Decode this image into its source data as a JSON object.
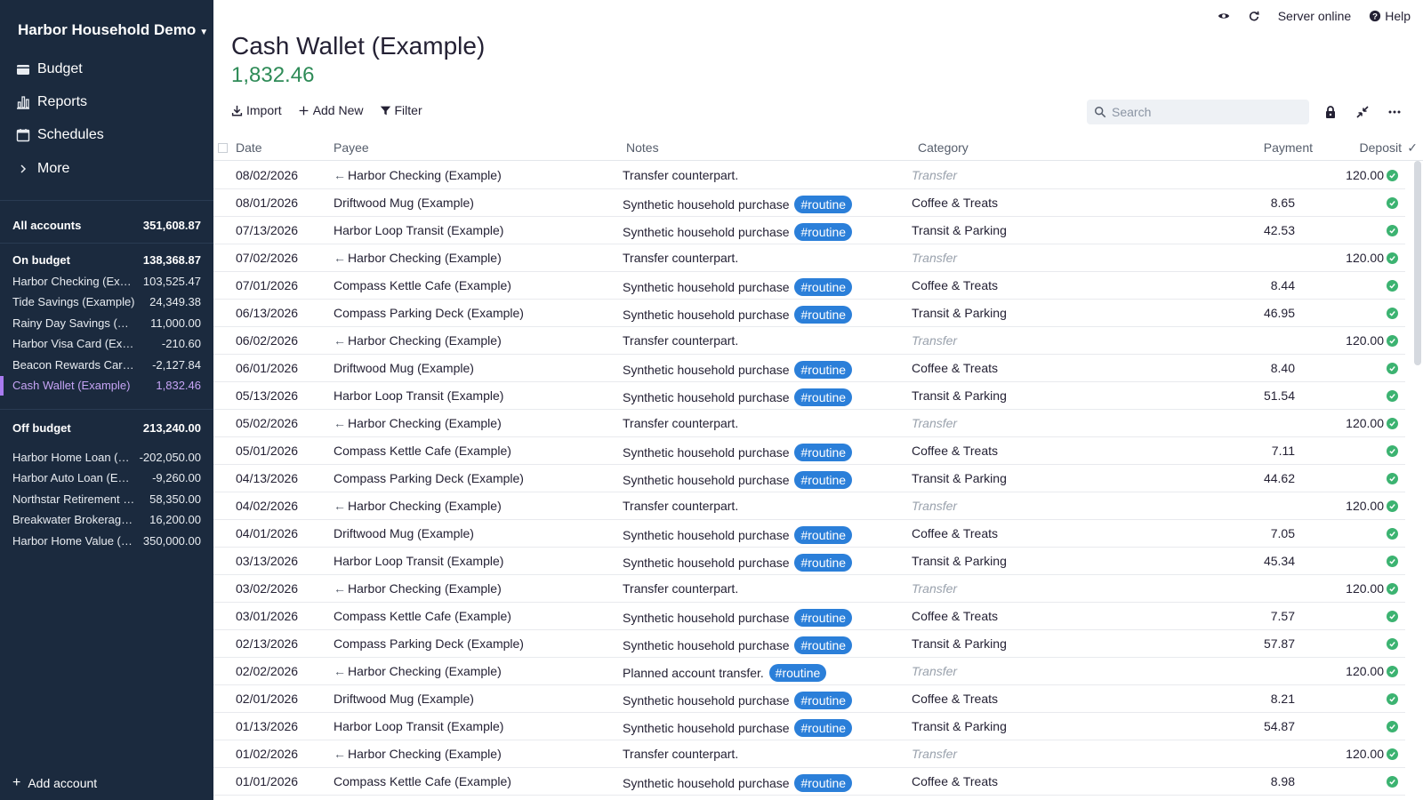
{
  "sidebar": {
    "budget_name": "Harbor Household Demo",
    "nav": [
      {
        "label": "Budget",
        "icon": "wallet-icon"
      },
      {
        "label": "Reports",
        "icon": "bar-chart-icon"
      },
      {
        "label": "Schedules",
        "icon": "calendar-icon"
      },
      {
        "label": "More",
        "icon": "chevron-right-icon"
      }
    ],
    "all_accounts": {
      "label": "All accounts",
      "balance": "351,608.87"
    },
    "on_budget": {
      "label": "On budget",
      "balance": "138,368.87",
      "accounts": [
        {
          "name": "Harbor Checking (Example)",
          "balance": "103,525.47"
        },
        {
          "name": "Tide Savings (Example)",
          "balance": "24,349.38"
        },
        {
          "name": "Rainy Day Savings (Example)",
          "balance": "11,000.00"
        },
        {
          "name": "Harbor Visa Card (Example)",
          "balance": "-210.60"
        },
        {
          "name": "Beacon Rewards Card (Example)",
          "balance": "-2,127.84"
        },
        {
          "name": "Cash Wallet (Example)",
          "balance": "1,832.46",
          "selected": true
        }
      ]
    },
    "off_budget": {
      "label": "Off budget",
      "balance": "213,240.00",
      "accounts": [
        {
          "name": "Harbor Home Loan (Example)",
          "balance": "-202,050.00"
        },
        {
          "name": "Harbor Auto Loan (Example)",
          "balance": "-9,260.00"
        },
        {
          "name": "Northstar Retirement (Example)",
          "balance": "58,350.00"
        },
        {
          "name": "Breakwater Brokerage (Example)",
          "balance": "16,200.00"
        },
        {
          "name": "Harbor Home Value (Example)",
          "balance": "350,000.00"
        }
      ]
    },
    "add_account": "Add account",
    "colors": {
      "background": "#1b2a3e",
      "selected": "#c6a4f5"
    }
  },
  "topbar": {
    "server_status": "Server online",
    "help": "Help"
  },
  "account": {
    "title": "Cash Wallet (Example)",
    "balance": "1,832.46",
    "balance_color": "#2e8b57"
  },
  "toolbar": {
    "import": "Import",
    "add_new": "Add New",
    "filter": "Filter"
  },
  "search": {
    "placeholder": "Search"
  },
  "table": {
    "headers": {
      "date": "Date",
      "payee": "Payee",
      "notes": "Notes",
      "category": "Category",
      "payment": "Payment",
      "deposit": "Deposit",
      "cleared": "✓"
    },
    "tag_color": "#2b7fd9",
    "rows": [
      {
        "date": "08/02/2026",
        "transfer": true,
        "payee": "Harbor Checking (Example)",
        "notes": "Transfer counterpart.",
        "tag": "",
        "category": "Transfer",
        "payment": "",
        "deposit": "120.00"
      },
      {
        "date": "08/01/2026",
        "transfer": false,
        "payee": "Driftwood Mug (Example)",
        "notes": "Synthetic household purchase",
        "tag": "#routine",
        "category": "Coffee & Treats",
        "payment": "8.65",
        "deposit": ""
      },
      {
        "date": "07/13/2026",
        "transfer": false,
        "payee": "Harbor Loop Transit (Example)",
        "notes": "Synthetic household purchase",
        "tag": "#routine",
        "category": "Transit & Parking",
        "payment": "42.53",
        "deposit": ""
      },
      {
        "date": "07/02/2026",
        "transfer": true,
        "payee": "Harbor Checking (Example)",
        "notes": "Transfer counterpart.",
        "tag": "",
        "category": "Transfer",
        "payment": "",
        "deposit": "120.00"
      },
      {
        "date": "07/01/2026",
        "transfer": false,
        "payee": "Compass Kettle Cafe (Example)",
        "notes": "Synthetic household purchase",
        "tag": "#routine",
        "category": "Coffee & Treats",
        "payment": "8.44",
        "deposit": ""
      },
      {
        "date": "06/13/2026",
        "transfer": false,
        "payee": "Compass Parking Deck (Example)",
        "notes": "Synthetic household purchase",
        "tag": "#routine",
        "category": "Transit & Parking",
        "payment": "46.95",
        "deposit": ""
      },
      {
        "date": "06/02/2026",
        "transfer": true,
        "payee": "Harbor Checking (Example)",
        "notes": "Transfer counterpart.",
        "tag": "",
        "category": "Transfer",
        "payment": "",
        "deposit": "120.00"
      },
      {
        "date": "06/01/2026",
        "transfer": false,
        "payee": "Driftwood Mug (Example)",
        "notes": "Synthetic household purchase",
        "tag": "#routine",
        "category": "Coffee & Treats",
        "payment": "8.40",
        "deposit": ""
      },
      {
        "date": "05/13/2026",
        "transfer": false,
        "payee": "Harbor Loop Transit (Example)",
        "notes": "Synthetic household purchase",
        "tag": "#routine",
        "category": "Transit & Parking",
        "payment": "51.54",
        "deposit": ""
      },
      {
        "date": "05/02/2026",
        "transfer": true,
        "payee": "Harbor Checking (Example)",
        "notes": "Transfer counterpart.",
        "tag": "",
        "category": "Transfer",
        "payment": "",
        "deposit": "120.00"
      },
      {
        "date": "05/01/2026",
        "transfer": false,
        "payee": "Compass Kettle Cafe (Example)",
        "notes": "Synthetic household purchase",
        "tag": "#routine",
        "category": "Coffee & Treats",
        "payment": "7.11",
        "deposit": ""
      },
      {
        "date": "04/13/2026",
        "transfer": false,
        "payee": "Compass Parking Deck (Example)",
        "notes": "Synthetic household purchase",
        "tag": "#routine",
        "category": "Transit & Parking",
        "payment": "44.62",
        "deposit": ""
      },
      {
        "date": "04/02/2026",
        "transfer": true,
        "payee": "Harbor Checking (Example)",
        "notes": "Transfer counterpart.",
        "tag": "",
        "category": "Transfer",
        "payment": "",
        "deposit": "120.00"
      },
      {
        "date": "04/01/2026",
        "transfer": false,
        "payee": "Driftwood Mug (Example)",
        "notes": "Synthetic household purchase",
        "tag": "#routine",
        "category": "Coffee & Treats",
        "payment": "7.05",
        "deposit": ""
      },
      {
        "date": "03/13/2026",
        "transfer": false,
        "payee": "Harbor Loop Transit (Example)",
        "notes": "Synthetic household purchase",
        "tag": "#routine",
        "category": "Transit & Parking",
        "payment": "45.34",
        "deposit": ""
      },
      {
        "date": "03/02/2026",
        "transfer": true,
        "payee": "Harbor Checking (Example)",
        "notes": "Transfer counterpart.",
        "tag": "",
        "category": "Transfer",
        "payment": "",
        "deposit": "120.00"
      },
      {
        "date": "03/01/2026",
        "transfer": false,
        "payee": "Compass Kettle Cafe (Example)",
        "notes": "Synthetic household purchase",
        "tag": "#routine",
        "category": "Coffee & Treats",
        "payment": "7.57",
        "deposit": ""
      },
      {
        "date": "02/13/2026",
        "transfer": false,
        "payee": "Compass Parking Deck (Example)",
        "notes": "Synthetic household purchase",
        "tag": "#routine",
        "category": "Transit & Parking",
        "payment": "57.87",
        "deposit": ""
      },
      {
        "date": "02/02/2026",
        "transfer": true,
        "payee": "Harbor Checking (Example)",
        "notes": "Planned account transfer.",
        "tag": "#routine",
        "category": "Transfer",
        "payment": "",
        "deposit": "120.00"
      },
      {
        "date": "02/01/2026",
        "transfer": false,
        "payee": "Driftwood Mug (Example)",
        "notes": "Synthetic household purchase",
        "tag": "#routine",
        "category": "Coffee & Treats",
        "payment": "8.21",
        "deposit": ""
      },
      {
        "date": "01/13/2026",
        "transfer": false,
        "payee": "Harbor Loop Transit (Example)",
        "notes": "Synthetic household purchase",
        "tag": "#routine",
        "category": "Transit & Parking",
        "payment": "54.87",
        "deposit": ""
      },
      {
        "date": "01/02/2026",
        "transfer": true,
        "payee": "Harbor Checking (Example)",
        "notes": "Transfer counterpart.",
        "tag": "",
        "category": "Transfer",
        "payment": "",
        "deposit": "120.00"
      },
      {
        "date": "01/01/2026",
        "transfer": false,
        "payee": "Compass Kettle Cafe (Example)",
        "notes": "Synthetic household purchase",
        "tag": "#routine",
        "category": "Coffee & Treats",
        "payment": "8.98",
        "deposit": ""
      }
    ]
  }
}
